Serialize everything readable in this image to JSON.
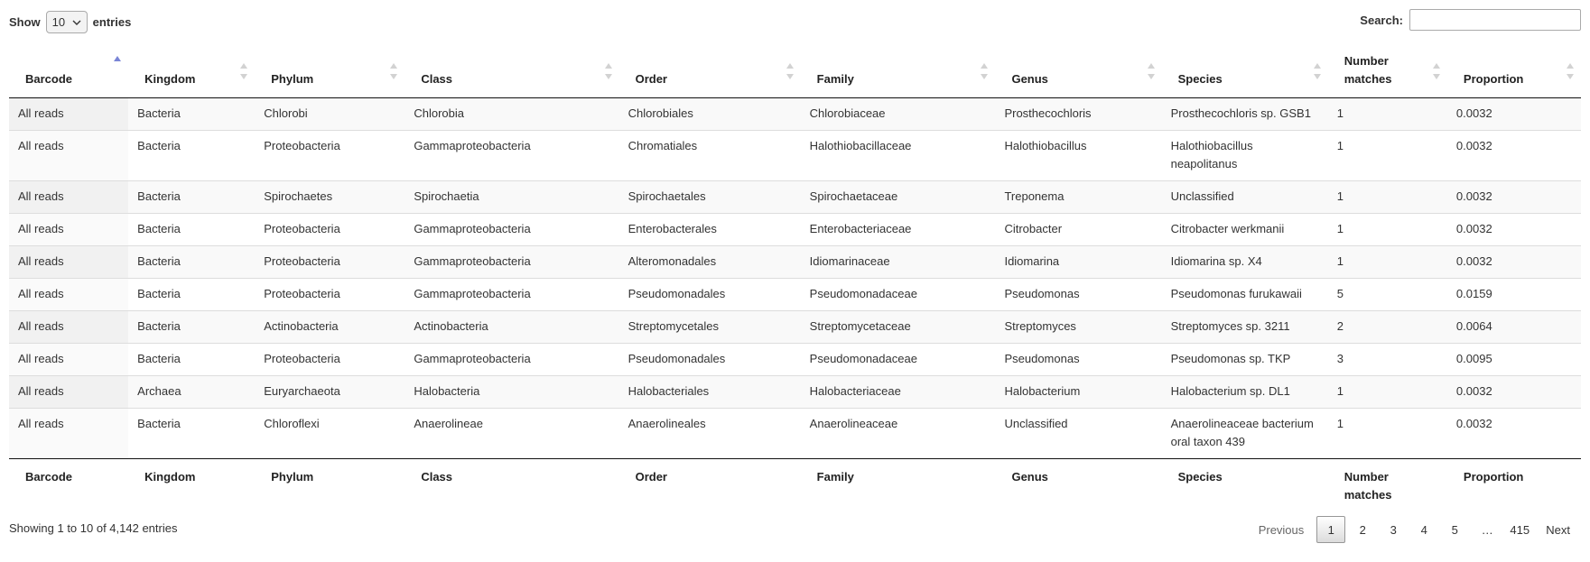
{
  "length_control": {
    "show_label": "Show",
    "selected": "10",
    "entries_label": "entries"
  },
  "search": {
    "label": "Search:",
    "value": ""
  },
  "columns": [
    "Barcode",
    "Kingdom",
    "Phylum",
    "Class",
    "Order",
    "Family",
    "Genus",
    "Species",
    "Number matches",
    "Proportion"
  ],
  "rows": [
    [
      "All reads",
      "Bacteria",
      "Chlorobi",
      "Chlorobia",
      "Chlorobiales",
      "Chlorobiaceae",
      "Prosthecochloris",
      "Prosthecochloris sp. GSB1",
      "1",
      "0.0032"
    ],
    [
      "All reads",
      "Bacteria",
      "Proteobacteria",
      "Gammaproteobacteria",
      "Chromatiales",
      "Halothiobacillaceae",
      "Halothiobacillus",
      "Halothiobacillus neapolitanus",
      "1",
      "0.0032"
    ],
    [
      "All reads",
      "Bacteria",
      "Spirochaetes",
      "Spirochaetia",
      "Spirochaetales",
      "Spirochaetaceae",
      "Treponema",
      "Unclassified",
      "1",
      "0.0032"
    ],
    [
      "All reads",
      "Bacteria",
      "Proteobacteria",
      "Gammaproteobacteria",
      "Enterobacterales",
      "Enterobacteriaceae",
      "Citrobacter",
      "Citrobacter werkmanii",
      "1",
      "0.0032"
    ],
    [
      "All reads",
      "Bacteria",
      "Proteobacteria",
      "Gammaproteobacteria",
      "Alteromonadales",
      "Idiomarinaceae",
      "Idiomarina",
      "Idiomarina sp. X4",
      "1",
      "0.0032"
    ],
    [
      "All reads",
      "Bacteria",
      "Proteobacteria",
      "Gammaproteobacteria",
      "Pseudomonadales",
      "Pseudomonadaceae",
      "Pseudomonas",
      "Pseudomonas furukawaii",
      "5",
      "0.0159"
    ],
    [
      "All reads",
      "Bacteria",
      "Actinobacteria",
      "Actinobacteria",
      "Streptomycetales",
      "Streptomycetaceae",
      "Streptomyces",
      "Streptomyces sp. 3211",
      "2",
      "0.0064"
    ],
    [
      "All reads",
      "Bacteria",
      "Proteobacteria",
      "Gammaproteobacteria",
      "Pseudomonadales",
      "Pseudomonadaceae",
      "Pseudomonas",
      "Pseudomonas sp. TKP",
      "3",
      "0.0095"
    ],
    [
      "All reads",
      "Archaea",
      "Euryarchaeota",
      "Halobacteria",
      "Halobacteriales",
      "Halobacteriaceae",
      "Halobacterium",
      "Halobacterium sp. DL1",
      "1",
      "0.0032"
    ],
    [
      "All reads",
      "Bacteria",
      "Chloroflexi",
      "Anaerolineae",
      "Anaerolineales",
      "Anaerolineaceae",
      "Unclassified",
      "Anaerolineaceae bacterium oral taxon 439",
      "1",
      "0.0032"
    ]
  ],
  "sort": {
    "column": "Barcode",
    "direction": "ascending"
  },
  "info_text": "Showing 1 to 10 of 4,142 entries",
  "pagination": {
    "previous": "Previous",
    "pages": [
      "1",
      "2",
      "3",
      "4",
      "5"
    ],
    "ellipsis": "…",
    "last": "415",
    "next": "Next",
    "current": "1"
  },
  "colors": {
    "sort_active": "#7a85d6",
    "sort_inactive": "#d2d2d2",
    "header_rule": "#111111",
    "row_rule": "#dddddd"
  }
}
